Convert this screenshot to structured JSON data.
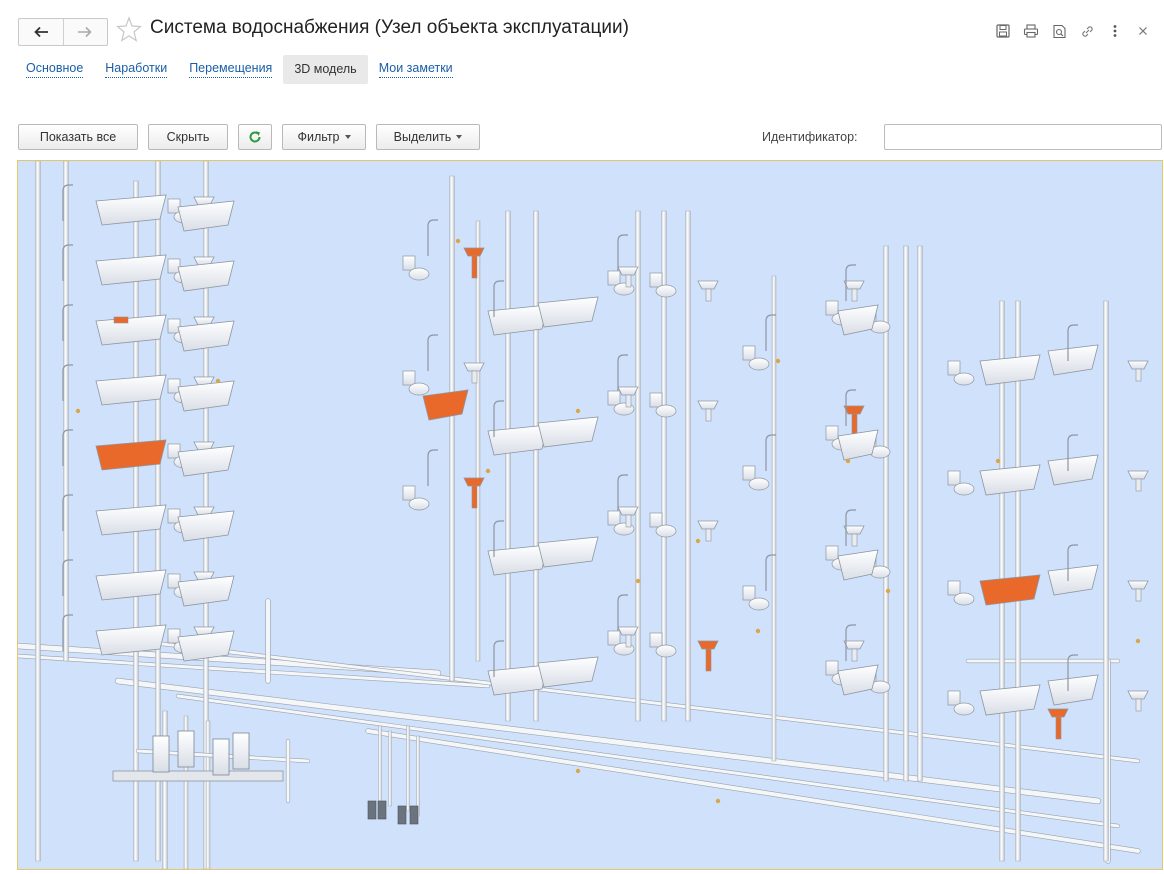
{
  "window": {
    "title": "Система водоснабжения (Узел объекта эксплуатации)"
  },
  "icons": {
    "back": "arrow-left-icon",
    "forward": "arrow-right-icon",
    "favorite": "star-icon",
    "save": "floppy-disk-icon",
    "print": "printer-icon",
    "preview": "print-preview-icon",
    "link": "link-icon",
    "more": "more-vertical-icon",
    "close": "close-icon",
    "refresh": "refresh-icon"
  },
  "tabs": [
    {
      "label": "Основное"
    },
    {
      "label": "Наработки"
    },
    {
      "label": "Перемещения"
    },
    {
      "label": "3D модель"
    },
    {
      "label": "Мои заметки"
    }
  ],
  "toolbar": {
    "show_all": "Показать все",
    "hide": "Скрыть",
    "filter": "Фильтр",
    "select": "Выделить",
    "identifier_label": "Идентификатор:",
    "identifier_value": ""
  },
  "colors": {
    "viewport_bg": "#cfe1fb",
    "highlight": "#e8692a",
    "pipe": "#f2f4f6",
    "link": "#1a5ea8",
    "refresh": "#2e9a3c"
  }
}
